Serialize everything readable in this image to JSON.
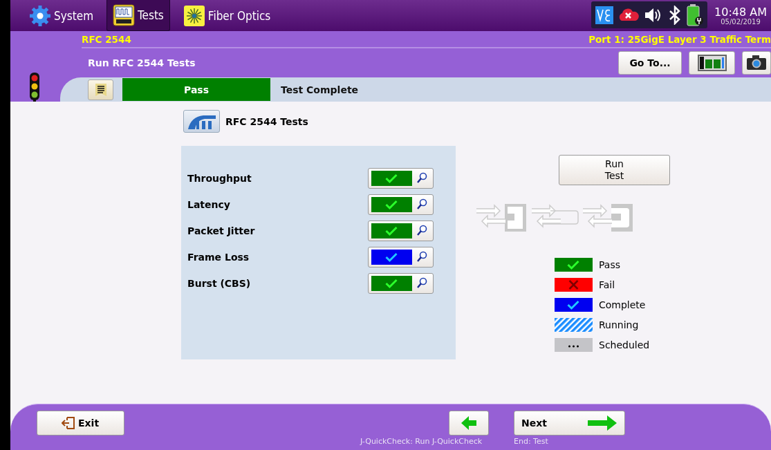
{
  "top_bar": {
    "tabs": [
      {
        "label": "System",
        "kind": "gear",
        "selected": false
      },
      {
        "label": "Tests",
        "kind": "bert",
        "selected": true
      },
      {
        "label": "Fiber Optics",
        "kind": "fiber",
        "selected": false
      }
    ],
    "time": "10:48 AM",
    "date": "05/02/2019"
  },
  "header": {
    "section": "RFC 2544",
    "port": "Port 1: 25GigE Layer 3 Traffic Term",
    "title": "Run RFC 2544 Tests",
    "goto_button": "Go To..."
  },
  "status_strip": {
    "result": {
      "label": "Pass",
      "kind": "pass"
    },
    "message": "Test Complete"
  },
  "suite": {
    "title": "RFC 2544 Tests"
  },
  "tests": [
    {
      "name": "Throughput",
      "kind": "pass"
    },
    {
      "name": "Latency",
      "kind": "pass"
    },
    {
      "name": "Packet Jitter",
      "kind": "pass"
    },
    {
      "name": "Frame Loss",
      "kind": "complete"
    },
    {
      "name": "Burst (CBS)",
      "kind": "pass"
    }
  ],
  "run_button": {
    "label": "Run\nTest"
  },
  "legend": [
    {
      "label": "Pass",
      "kind": "pass"
    },
    {
      "label": "Fail",
      "kind": "fail"
    },
    {
      "label": "Complete",
      "kind": "complete"
    },
    {
      "label": "Running",
      "kind": "running"
    },
    {
      "label": "Scheduled",
      "kind": "scheduled"
    }
  ],
  "footer": {
    "exit": "Exit",
    "back_caption": "J-QuickCheck: Run J-QuickCheck",
    "next": "Next",
    "next_caption": "End: Test"
  }
}
